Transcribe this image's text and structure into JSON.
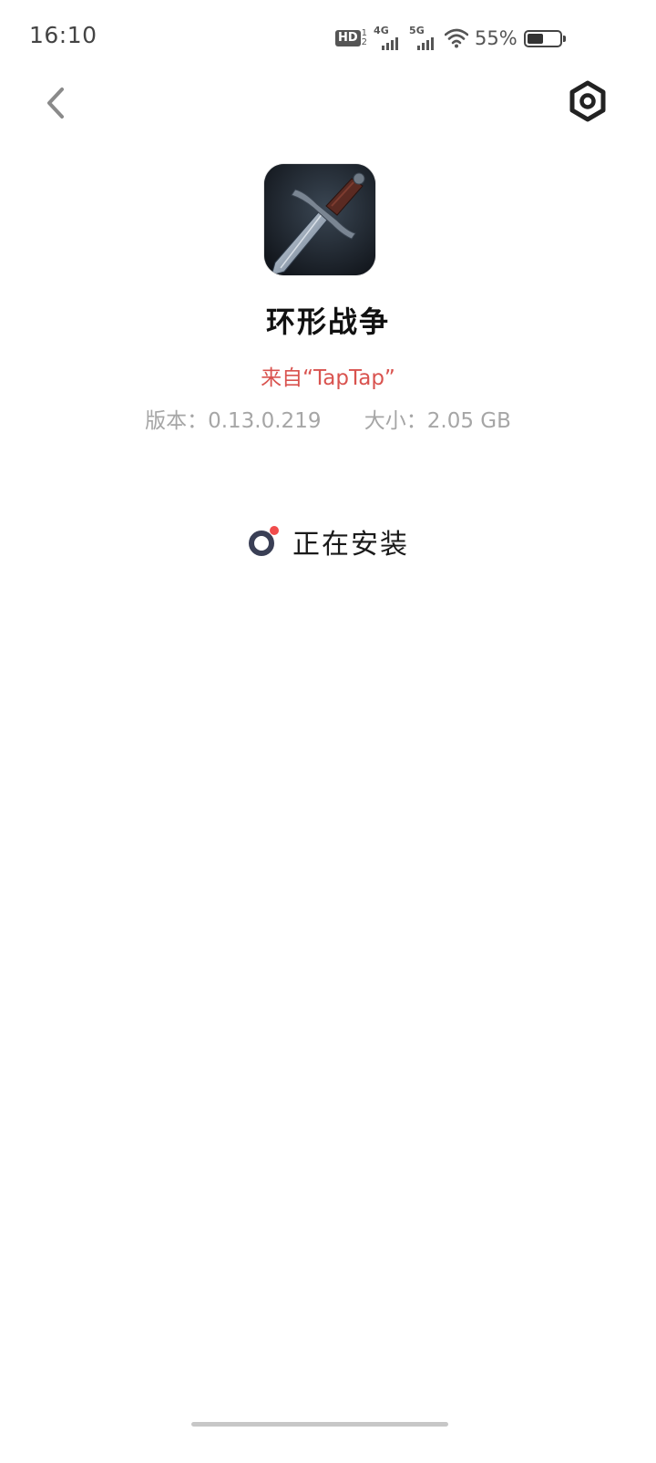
{
  "status_bar": {
    "time": "16:10",
    "hd_label": "HD",
    "hd_sub_top": "1",
    "hd_sub_bottom": "2",
    "signal_1_label": "4G",
    "signal_2_label": "5G",
    "battery_percent": "55%",
    "battery_level": 0.55
  },
  "header": {
    "back_icon": "chevron-left-icon",
    "settings_icon": "hex-settings-icon"
  },
  "app": {
    "name": "环形战争",
    "source": "来自“TapTap”",
    "version": "版本：0.13.0.219",
    "size": "大小：2.05 GB"
  },
  "install": {
    "status_label": "正在安装",
    "spinner_colors": {
      "ring": "#3a3f55",
      "dot": "#f04c4c"
    }
  },
  "colors": {
    "source_text": "#d9534f",
    "meta_text": "#a6a6a6"
  }
}
